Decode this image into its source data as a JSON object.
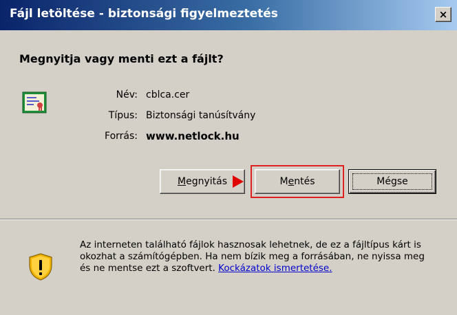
{
  "window": {
    "title": "Fájl letöltése - biztonsági figyelmeztetés",
    "close_label": "×"
  },
  "dialog": {
    "question": "Megnyitja vagy menti ezt a fájlt?",
    "file_info": {
      "name_label": "Név:",
      "name_value": "cblca.cer",
      "type_label": "Típus:",
      "type_value": "Biztonsági tanúsítvány",
      "source_label": "Forrás:",
      "source_value": "www.netlock.hu"
    },
    "buttons": {
      "open_prefix": "",
      "open_underlined": "M",
      "open_rest": "egnyitás",
      "save_prefix": "M",
      "save_underlined": "e",
      "save_rest": "ntés",
      "cancel": "Mégse"
    },
    "warning": {
      "text": "Az interneten található fájlok hasznosak lehetnek, de ez a fájltípus kárt is okozhat a számítógépben. Ha nem bízik meg a forrásában, ne nyissa meg és ne mentse ezt a szoftvert. ",
      "link": "Kockázatok ismertetése."
    }
  },
  "icons": {
    "certificate": "certificate-icon",
    "warning_shield": "warning-shield-icon",
    "arrow": "red-arrow-icon"
  },
  "colors": {
    "title_gradient_start": "#0a246a",
    "title_gradient_end": "#a6caf0",
    "dialog_bg": "#d4d0c8",
    "highlight": "#e02020",
    "link": "#0000cc"
  }
}
